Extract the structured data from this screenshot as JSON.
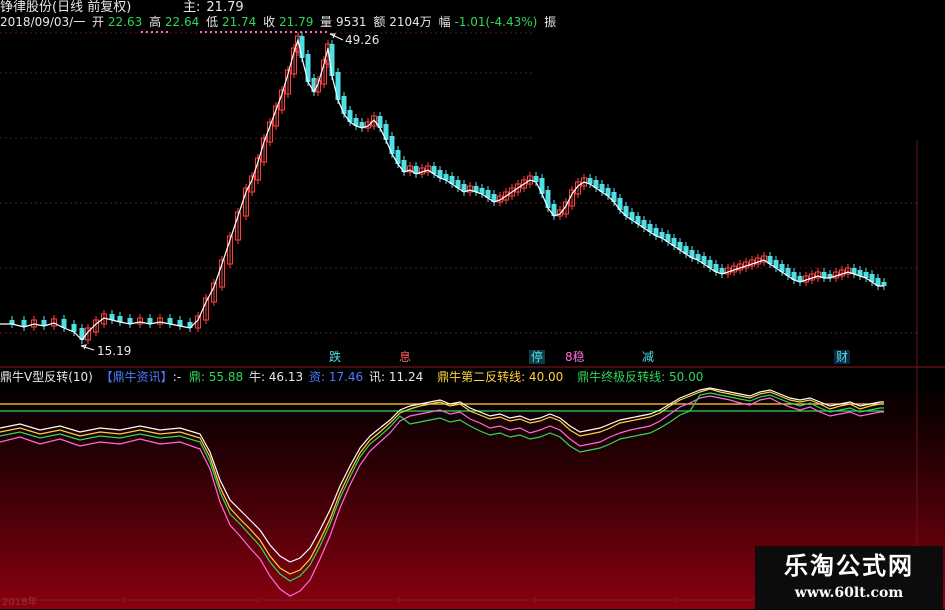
{
  "header": {
    "stock_name": "铮律股份(日线 前复权)",
    "date": "2018/09/03/一",
    "open_label": "开",
    "open_value": "22.63",
    "high_label": "高",
    "high_value": "22.64",
    "low_label": "低",
    "low_value": "21.74",
    "close_label": "收",
    "close_value": "21.79",
    "volume_label": "量",
    "volume_value": "9531",
    "amount_label": "额",
    "amount_value": "2104万",
    "change_label": "幅",
    "change_value": "-1.01(-4.43%)",
    "amplitude_label": "振",
    "price_tag_label": "主",
    "price_tag_value": "21.79"
  },
  "price_annotations": {
    "max_label": "49.26",
    "min_label": "15.19"
  },
  "event_badges": [
    {
      "text": "跌",
      "color": "#4fe0e6"
    },
    {
      "text": "息",
      "color": "#ff5a5a"
    },
    {
      "text": "停",
      "color": "#4fe0e6"
    },
    {
      "text": "8稳",
      "color": "#ff6adf"
    },
    {
      "text": "减",
      "color": "#4fe0e6"
    },
    {
      "text": "财",
      "color": "#4fe0e6"
    }
  ],
  "indicator": {
    "name": "鼎牛V型反转(10)",
    "info_tag": "【鼎牛资讯】",
    "info_suffix": ":-",
    "ding_label": "鼎: 55.88",
    "niu_label": "牛: 46.13",
    "zi_label": "资: 17.46",
    "xun_label": "讯: 11.24",
    "second_label": "鼎牛第二反转线: 40.00",
    "final_label": "鼎牛终极反转线: 50.00"
  },
  "bottom_axis": {
    "year_label": "2018年"
  },
  "watermark": {
    "title": "乐淘公式网",
    "url": "www.60lt.com"
  },
  "colors": {
    "up_candle": "#ff4040",
    "down_candle": "#4fe0e6",
    "ma_line": "#ffffff",
    "ding_line": "#ffffff",
    "niu_line": "#ffd23a",
    "zi_line": "#ff6adf",
    "xun_line": "#2fd65b",
    "ref_line_40": "#2fd65b",
    "ref_line_50": "#ffd23a"
  }
}
